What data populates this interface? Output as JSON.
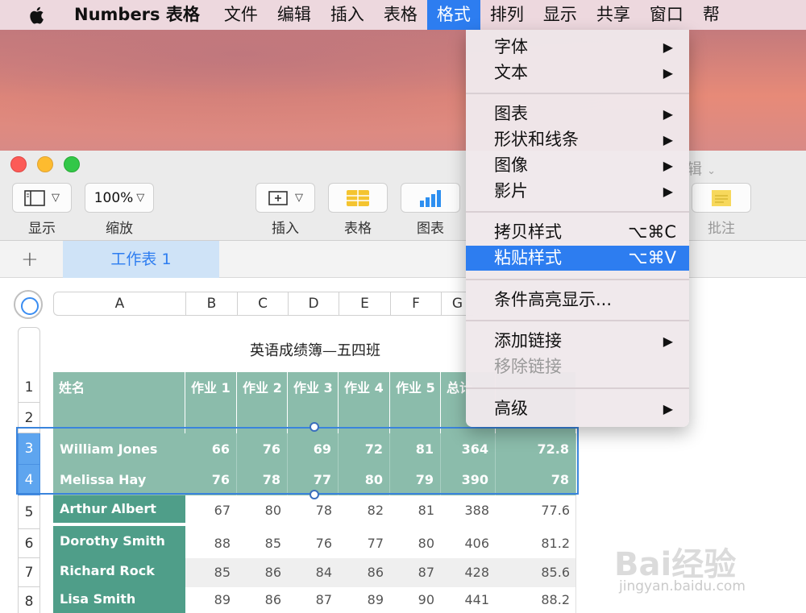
{
  "menubar": {
    "app_name": "Numbers 表格",
    "items": [
      "文件",
      "编辑",
      "插入",
      "表格",
      "格式",
      "排列",
      "显示",
      "共享",
      "窗口",
      "帮"
    ],
    "active": "格式"
  },
  "toolbar": {
    "view_label": "显示",
    "zoom_value": "100%",
    "zoom_label": "缩放",
    "insert_label": "插入",
    "table_label": "表格",
    "chart_label": "图表",
    "comment_label": "批注",
    "edit_ghost": "辑"
  },
  "sheets": {
    "add": "+",
    "tab1": "工作表 1"
  },
  "columns": [
    "A",
    "B",
    "C",
    "D",
    "E",
    "F",
    "G"
  ],
  "rows": [
    "1",
    "2",
    "3",
    "4",
    "5",
    "6",
    "7",
    "8"
  ],
  "table": {
    "title": "英语成绩簿—五四班",
    "headers": [
      "姓名",
      "作业 1",
      "作业 2",
      "作业 3",
      "作业 4",
      "作业 5",
      "总计"
    ],
    "data": [
      {
        "name": "William Jones",
        "vals": [
          "66",
          "76",
          "69",
          "72",
          "81",
          "364",
          "72.8"
        ]
      },
      {
        "name": "Melissa Hay",
        "vals": [
          "76",
          "78",
          "77",
          "80",
          "79",
          "390",
          "78"
        ]
      },
      {
        "name": "Arthur Albert",
        "vals": [
          "67",
          "80",
          "78",
          "82",
          "81",
          "388",
          "77.6"
        ]
      },
      {
        "name": "Dorothy Smith",
        "vals": [
          "88",
          "85",
          "76",
          "77",
          "80",
          "406",
          "81.2"
        ]
      },
      {
        "name": "Richard Rock",
        "vals": [
          "85",
          "86",
          "84",
          "86",
          "87",
          "428",
          "85.6"
        ]
      },
      {
        "name": "Lisa Smith",
        "vals": [
          "89",
          "86",
          "87",
          "89",
          "90",
          "441",
          "88.2"
        ]
      }
    ]
  },
  "format_menu": {
    "font": "字体",
    "text": "文本",
    "chart": "图表",
    "shapes_lines": "形状和线条",
    "image": "图像",
    "movie": "影片",
    "copy_style": "拷贝样式",
    "copy_style_shortcut": "⌥⌘C",
    "paste_style": "粘贴样式",
    "paste_style_shortcut": "⌥⌘V",
    "conditional_highlight": "条件高亮显示...",
    "add_link": "添加链接",
    "remove_link": "移除链接",
    "advanced": "高级"
  },
  "watermark": {
    "logo": "Bai经验",
    "url": "jingyan.baidu.com"
  }
}
